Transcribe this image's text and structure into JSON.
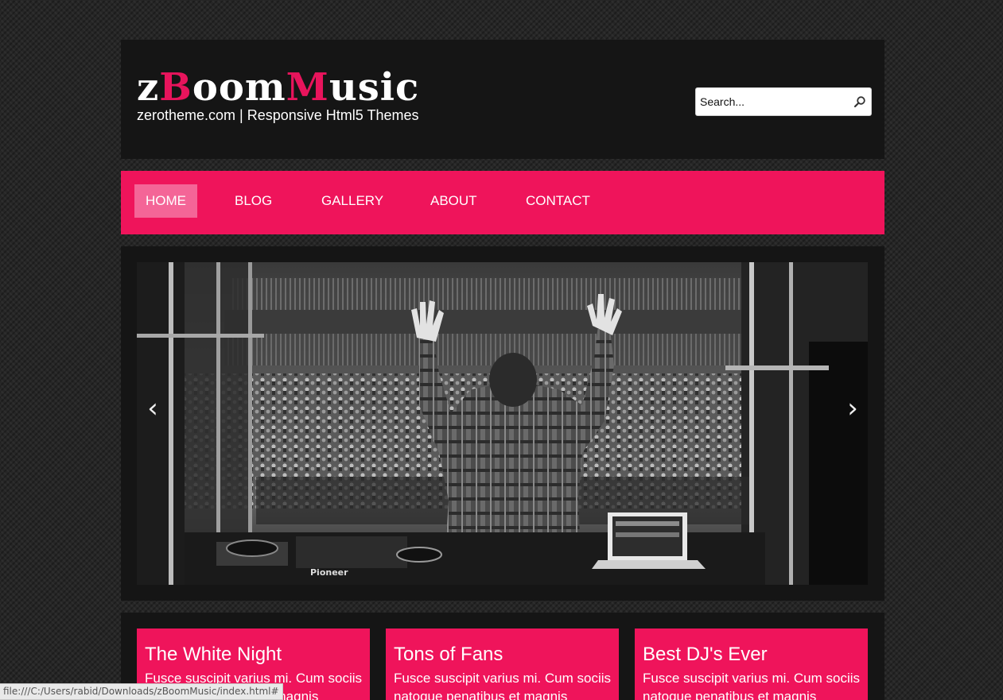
{
  "header": {
    "logo": {
      "part1": "z",
      "accent1": "B",
      "part2": "oom",
      "accent2": "M",
      "part3": "usic"
    },
    "tagline": "zerotheme.com | Responsive Html5 Themes",
    "search": {
      "placeholder": "Search...",
      "icon": "search-icon"
    }
  },
  "nav": {
    "items": [
      {
        "label": "HOME",
        "active": true
      },
      {
        "label": "BLOG",
        "active": false
      },
      {
        "label": "GALLERY",
        "active": false
      },
      {
        "label": "ABOUT",
        "active": false
      },
      {
        "label": "CONTACT",
        "active": false
      }
    ]
  },
  "slider": {
    "image_subject": "DJ with raised hands facing concert crowd (black and white)",
    "prev_arrow": "‹",
    "next_arrow": "›",
    "equipment_text": "Pioneer"
  },
  "features": [
    {
      "title": "The White Night",
      "text": "Fusce suscipit varius mi. Cum sociis natoque penatibus et magnis"
    },
    {
      "title": "Tons of Fans",
      "text": "Fusce suscipit varius mi. Cum sociis natoque penatibus et magnis"
    },
    {
      "title": "Best DJ's Ever",
      "text": "Fusce suscipit varius mi. Cum sociis natoque penatibus et magnis"
    }
  ],
  "status_bar": {
    "url": "file:///C:/Users/rabid/Downloads/zBoomMusic/index.html#"
  },
  "colors": {
    "accent": "#ef145b",
    "active_nav": "#f46597",
    "panel": "#151515",
    "background": "#262626"
  }
}
